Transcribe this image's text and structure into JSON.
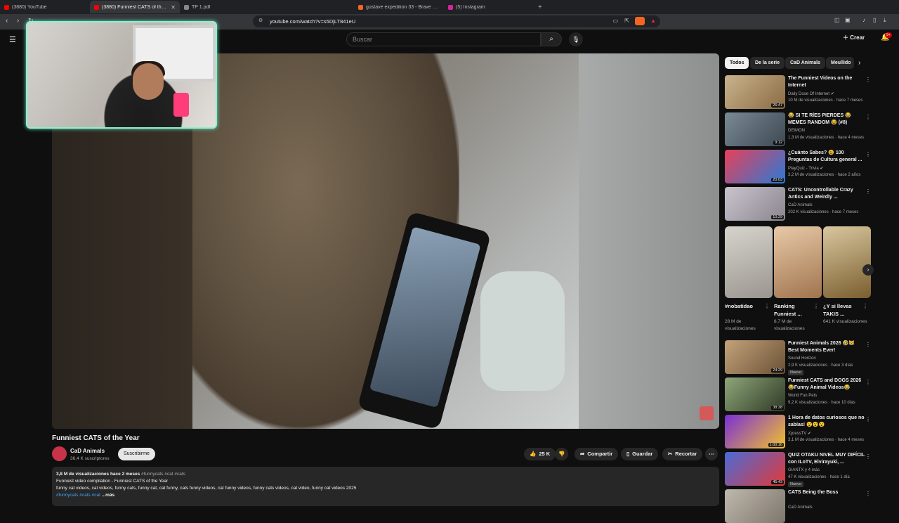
{
  "browser": {
    "tabs": [
      {
        "label": "(3880) YouTube",
        "color": "#ff0000"
      },
      {
        "label": "(3880) Funniest CATS of the Y",
        "color": "#ff0000",
        "active": true
      },
      {
        "label": "TP 1.pdf",
        "color": "#888888"
      },
      {
        "label": "gustave expedition 33 - Brave Search",
        "color": "#f26522"
      },
      {
        "label": "(5) Instagram",
        "color": "#d6249f"
      }
    ],
    "new_tab": "+",
    "url": "youtube.com/watch?v=s5DjLT841eU"
  },
  "header": {
    "search_placeholder": "Buscar",
    "create_label": "Crear",
    "notifications_badge": "9+"
  },
  "video": {
    "title": "Funniest CATS of the Year",
    "channel": "CaD Animals",
    "subscribers": "36,4 K suscriptores",
    "subscribe_label": "Suscribirme",
    "likes": "25 K",
    "share_label": "Compartir",
    "save_label": "Guardar",
    "clip_label": "Recortar",
    "description": {
      "meta": "3,8 M de visualizaciones  hace 2 meses",
      "meta_tags": "#funnycats #cat #cats",
      "line1": "Funniest video compilation - Funniest CATS of the Year",
      "line2": "funny cat videos, cat videos, funny cats, funny cat, cat funny, cats funny videos, cat funny videos, funny cats videos, cat video, funny cat videos 2025",
      "tags": "#funnycats #cats #cat",
      "more": "...más"
    }
  },
  "sidebar": {
    "chips": [
      "Todos",
      "De la serie",
      "CaD Animals",
      "Meullido"
    ],
    "videos_top": [
      {
        "title": "The Funniest Videos on the Internet",
        "channel": "Daily Dose Of Internet ✔",
        "stats": "10 M de visualizaciones · hace 7 meses",
        "duration": "26:47",
        "c1": "#c9b48d",
        "c2": "#8a6a44"
      },
      {
        "title": "😂 SI TE RÍES PIERDES 😂 MEMES RANDOM 😂 (#8)",
        "channel": "DEIMON",
        "stats": "1,3 M de visualizaciones · hace 4 meses",
        "duration": "9:12",
        "c1": "#7a8a95",
        "c2": "#3d4852"
      },
      {
        "title": "¿Cuánto Sabes? 😃 100 Preguntas de Cultura general ...",
        "channel": "PlayQuiz - Trivia ✔",
        "stats": "3,2 M de visualizaciones · hace 2 años",
        "duration": "20:03",
        "c1": "#e8405a",
        "c2": "#2a7ad6"
      },
      {
        "title": "CATS: Uncontrollable Crazy Antics and Weirdly ...",
        "channel": "CaD Animals",
        "stats": "202 K visualizaciones · hace 7 meses",
        "duration": "10:29",
        "c1": "#c9c4cc",
        "c2": "#8a8590"
      }
    ],
    "shorts": [
      {
        "title": "#nobatidao",
        "views": "28 M de visualizaciones",
        "c1": "#d7d3cd",
        "c2": "#9a958f"
      },
      {
        "title": "Ranking Funniest ...",
        "views": "8,7 M de visualizaciones",
        "c1": "#e8c9a8",
        "c2": "#a0744e"
      },
      {
        "title": "¿Y si llevas TAKIS ...",
        "views": "641 K visualizaciones",
        "c1": "#d9c7a0",
        "c2": "#7a5e2e"
      }
    ],
    "videos_bottom": [
      {
        "title": "Funniest Animals 2026 🤣😹 Best Moments Ever!",
        "channel": "Sound Horizon",
        "stats": "2,9 K visualizaciones · hace 3 días",
        "badge": "Nuevo",
        "duration": "24:29",
        "c1": "#c4a27a",
        "c2": "#6a5236"
      },
      {
        "title": "Funniest CATS and DOGS 2026 😂Funny Animal Videos😂",
        "channel": "World Fun Pets",
        "stats": "9,2 K visualizaciones · hace 10 días",
        "badge": "",
        "duration": "38:38",
        "c1": "#8fa67a",
        "c2": "#2e3a25"
      },
      {
        "title": "1 Hora de datos curiosos que no sabías! 😮😮😮",
        "channel": "XpressTV ✔",
        "stats": "3,1 M de visualizaciones · hace 4 meses",
        "badge": "",
        "duration": "1:00:16",
        "c1": "#7b2fd6",
        "c2": "#f2c12e"
      },
      {
        "title": "QUIZ OTAKU NIVEL MUY DIFÍCIL con ILoTV, Elvirayuki, ...",
        "channel": "GIANTX y 4 más",
        "stats": "47 K visualizaciones · hace 1 día",
        "badge": "Nuevo",
        "duration": "45:43",
        "c1": "#4a6ad6",
        "c2": "#e03a3a"
      },
      {
        "title": "CATS Being the Boss",
        "channel": "CaD Animals",
        "stats": "",
        "badge": "",
        "duration": "",
        "c1": "#bfb8ad",
        "c2": "#7d766c"
      }
    ]
  },
  "colors": {
    "accent": "#3ea6ff",
    "webcam_border": "#8ef0d0",
    "brand": "#ff0000"
  }
}
